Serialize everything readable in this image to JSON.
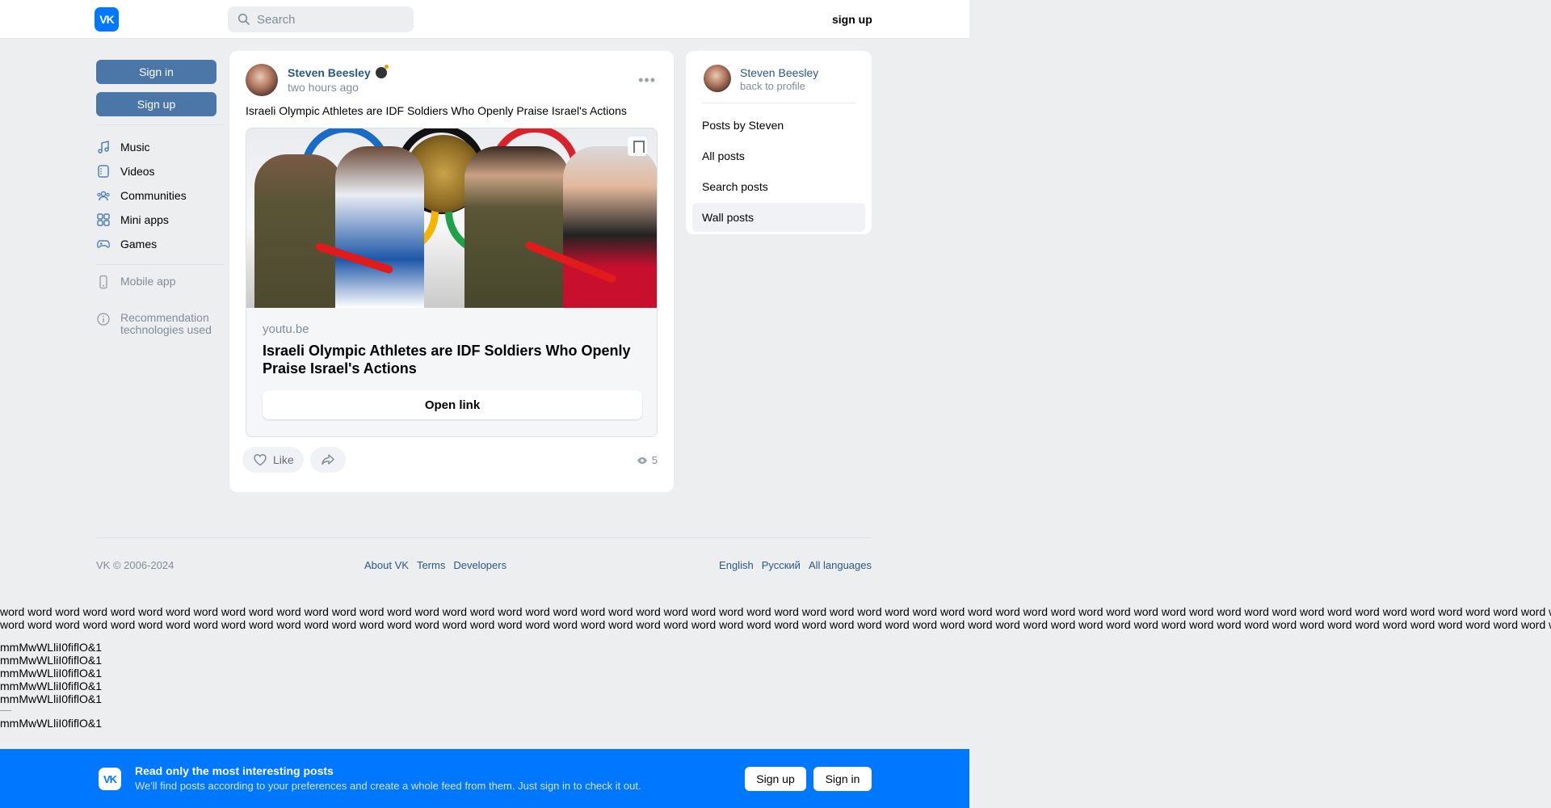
{
  "header": {
    "logo": "VK",
    "search_placeholder": "Search",
    "signup_label": "sign up"
  },
  "left": {
    "sign_in": "Sign in",
    "sign_up": "Sign up",
    "nav": [
      {
        "label": "Music",
        "icon": "music-icon"
      },
      {
        "label": "Videos",
        "icon": "video-icon"
      },
      {
        "label": "Communities",
        "icon": "communities-icon"
      },
      {
        "label": "Mini apps",
        "icon": "mini-apps-icon"
      },
      {
        "label": "Games",
        "icon": "gamepad-icon"
      }
    ],
    "mobile_app": "Mobile app",
    "recommendation": "Recommendation technologies used"
  },
  "post": {
    "author": "Steven Beesley",
    "time": "two hours ago",
    "text": "Israeli Olympic Athletes are IDF Soldiers Who Openly Praise Israel's Actions",
    "attachment": {
      "domain": "youtu.be",
      "title": "Israeli Olympic Athletes are IDF Soldiers Who Openly Praise Israel's Actions",
      "open_link": "Open link"
    },
    "like_label": "Like",
    "views": "5"
  },
  "right": {
    "name": "Steven Beesley",
    "back": "back to profile",
    "menu": [
      "Posts by Steven",
      "All posts",
      "Search posts",
      "Wall posts"
    ]
  },
  "footer": {
    "copyright": "VK © 2006-2024",
    "links": [
      "About VK",
      "Terms",
      "Developers"
    ],
    "languages": [
      "English",
      "Русский",
      "All languages"
    ]
  },
  "filler": {
    "word_line_1": "word word word word word word word word word word word word word word word word word word word word word word word word word word word word word word word word word word word word word word word word word word word word word word word word word word word word word word word word word word word word word word",
    "word_line_2": "word word word word word word word word word word word word word word word word word word word word word word word word word word word word word word word word word word word word word word word word word word word word word word word word word word word word word word word word word word word word word word",
    "test_string": "mmMwWLliI0fiflO&1"
  },
  "banner": {
    "title": "Read only the most interesting posts",
    "text": "We'll find posts according to your preferences and create a whole feed from them. Just sign in to check it out.",
    "sign_up": "Sign up",
    "sign_in": "Sign in"
  }
}
